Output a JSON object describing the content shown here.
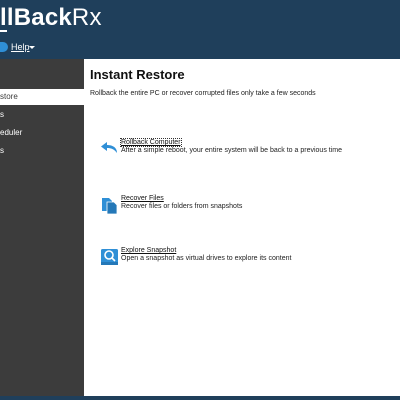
{
  "app": {
    "title_bold": "llBack",
    "title_light": "Rx"
  },
  "menu": {
    "help_label": "Help",
    "help_icon": "help-circle-icon"
  },
  "sidebar": {
    "items": [
      {
        "label": ""
      },
      {
        "label": "store",
        "active": true
      },
      {
        "label": "s"
      },
      {
        "label": "eduler"
      },
      {
        "label": "s"
      }
    ]
  },
  "main": {
    "title": "Instant Restore",
    "description": "Rollback the entire PC or recover corrupted files only take a few seconds",
    "options": [
      {
        "label": "Rollback Computer",
        "description": "After a simple reboot, your entire system will be back to a previous time",
        "icon": "rollback-arrow-icon"
      },
      {
        "label": "Recover Files",
        "description": "Recover files or folders from snapshots",
        "icon": "recover-files-icon"
      },
      {
        "label": "Explore Snapshot",
        "description": "Open a snapshot as virtual drives to explore its content",
        "icon": "explore-snapshot-icon"
      }
    ]
  },
  "colors": {
    "header_bg": "#1f3f5b",
    "sidebar_bg": "#3c3c3c",
    "accent_blue": "#2f8fd6"
  }
}
